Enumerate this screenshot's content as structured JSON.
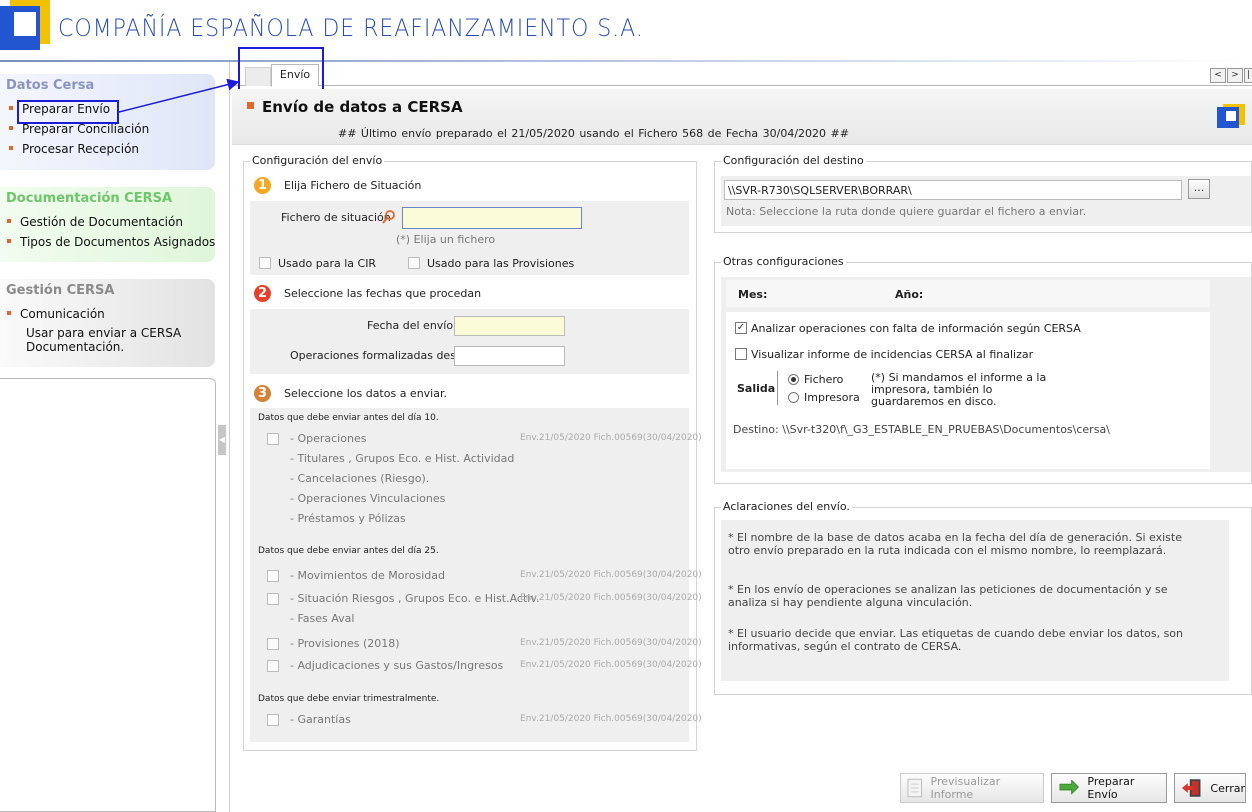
{
  "header": {
    "company": "COMPAÑÍA ESPAÑOLA DE REAFIANZAMIENTO S.A."
  },
  "sidebar": {
    "sections": [
      {
        "title": "Datos Cersa",
        "title_color": "#8a94c4",
        "items": [
          "Preparar Envío",
          "Preparar Conciliación",
          "Procesar Recepción"
        ]
      },
      {
        "title": "Documentación CERSA",
        "title_color": "#6dc66a",
        "items": [
          "Gestión de Documentación",
          "Tipos de Documentos Asignados"
        ]
      },
      {
        "title": "Gestión CERSA",
        "title_color": "#8a8a8a",
        "items": [
          "Comunicación"
        ],
        "note_lines": [
          "Usar para enviar a CERSA",
          "Documentación."
        ]
      }
    ]
  },
  "tabs": {
    "active": "Envío"
  },
  "nav": {
    "prev": "<",
    "next": ">",
    "more": "|"
  },
  "page": {
    "title": "Envío de datos a CERSA",
    "subtitle": "##  Último envío preparado el  21/05/2020  usando el Fichero 568  de Fecha 30/04/2020  ##"
  },
  "config": {
    "title": "Configuración del envío",
    "step1": {
      "num": "1",
      "label": "Elija Fichero de Situación",
      "field_label": "Fichero de situación",
      "hint": "(*) Elija un fichero",
      "chk_cir": "Usado para la CIR",
      "chk_prov": "Usado para las Provisiones"
    },
    "step2": {
      "num": "2",
      "label": "Seleccione las fechas que procedan",
      "fecha_envio": "Fecha del envío",
      "ops_desde": "Operaciones formalizadas desde"
    },
    "step3": {
      "num": "3",
      "label": "Seleccione los datos a enviar."
    },
    "groups": [
      {
        "heading": "Datos que debe enviar antes del día 10.",
        "items": [
          {
            "label": "- Operaciones",
            "check": true,
            "env": "Env.21/05/2020 Fich.00569(30/04/2020)"
          },
          {
            "label": "- Titulares , Grupos Eco.  e  Hist. Actividad",
            "check": false,
            "env": ""
          },
          {
            "label": "- Cancelaciones (Riesgo).",
            "check": false,
            "env": ""
          },
          {
            "label": "- Operaciones Vinculaciones",
            "check": false,
            "env": ""
          },
          {
            "label": "- Préstamos  y  Pólizas",
            "check": false,
            "env": ""
          }
        ]
      },
      {
        "heading": "Datos que debe enviar antes del día 25.",
        "items": [
          {
            "label": "- Movimientos de Morosidad",
            "check": true,
            "env": "Env.21/05/2020 Fich.00569(30/04/2020)"
          },
          {
            "label": "- Situación Riesgos , Grupos Eco. e Hist.Activ.",
            "check": true,
            "env": "Env.21/05/2020 Fich.00569(30/04/2020)"
          },
          {
            "label": "- Fases Aval",
            "check": false,
            "env": ""
          },
          {
            "label": "- Provisiones (2018)",
            "check": true,
            "env": "Env.21/05/2020 Fich.00569(30/04/2020)"
          },
          {
            "label": "- Adjudicaciones y sus Gastos/Ingresos",
            "check": true,
            "env": "Env.21/05/2020 Fich.00569(30/04/2020)"
          }
        ]
      },
      {
        "heading": "Datos que debe enviar trimestralmente.",
        "items": [
          {
            "label": "- Garantías",
            "check": true,
            "env": "Env.21/05/2020 Fich.00569(30/04/2020)"
          }
        ]
      }
    ]
  },
  "destino": {
    "title": "Configuración del destino",
    "path": "\\\\SVR-R730\\SQLSERVER\\BORRAR\\",
    "browse": "...",
    "note": "Nota: Seleccione la ruta donde quiere guardar el fichero a enviar."
  },
  "otras": {
    "title": "Otras configuraciones",
    "mes": "Mes:",
    "anio": "Año:",
    "chk_analizar": "Analizar operaciones con falta de información según CERSA",
    "chk_visualizar": "Visualizar informe de incidencias CERSA al finalizar",
    "salida": "Salida",
    "opt_fichero": "Fichero",
    "opt_impresora": "Impresora",
    "salida_note": "(*) Si mandamos el informe a la impresora, también lo guardaremos en disco.",
    "destino_text": "Destino: \\\\Svr-t320\\f\\_G3_ESTABLE_EN_PRUEBAS\\Documentos\\cersa\\"
  },
  "aclaraciones": {
    "title": "Aclaraciones del envío.",
    "p1": "* El nombre de la base de datos acaba en la fecha del día de generación. Si existe otro envío preparado en la ruta indicada con el mismo nombre, lo reemplazará.",
    "p2": "* En los envío de operaciones se analizan las peticiones de documentación y se analiza si hay pendiente alguna vinculación.",
    "p3": "* El usuario decide que enviar. Las etiquetas de cuando debe enviar los datos, son informativas, según el contrato de CERSA."
  },
  "buttons": {
    "preview": "Previsualizar Informe",
    "prepare": "Preparar Envío",
    "close": "Cerrar"
  },
  "colors": {
    "accent": "#e0682e",
    "brand_blue": "#2a4fb0",
    "annotation": "#1c1cd8"
  }
}
